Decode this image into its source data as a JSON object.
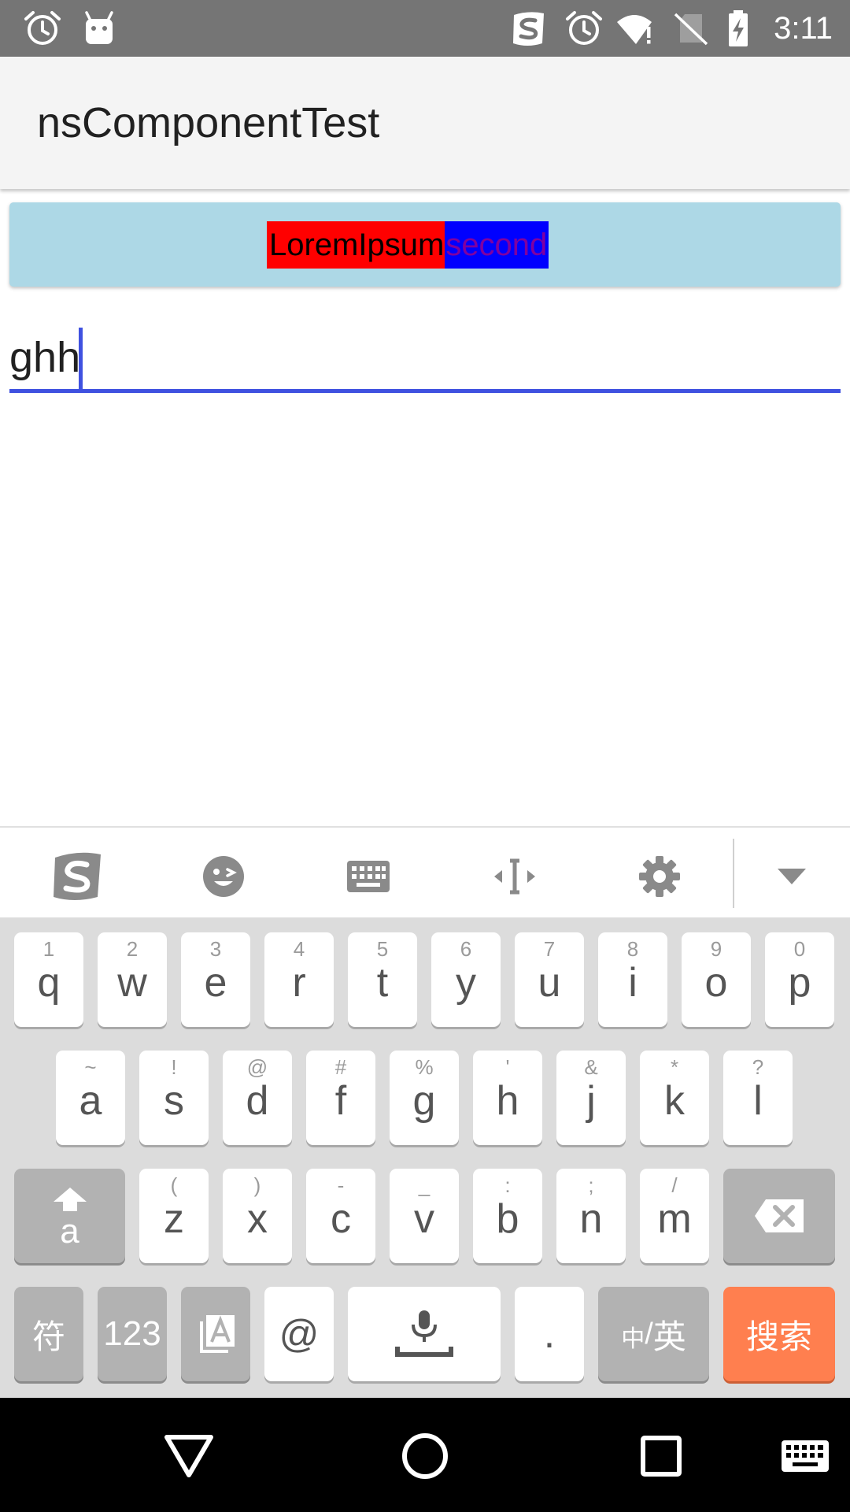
{
  "status_bar": {
    "time": "3:11",
    "icons": [
      "alarm-icon",
      "android-debug-icon",
      "sogou-icon",
      "alarm-icon",
      "wifi-warning-icon",
      "no-sim-icon",
      "battery-charging-icon"
    ],
    "background": "#757575"
  },
  "app_bar": {
    "title": "nsComponentTest",
    "background": "#f4f4f4"
  },
  "component": {
    "first_label": "LoremIpsum",
    "second_label": "second",
    "background": "#add8e6",
    "first_bg": "#ff0000",
    "second_bg": "#0000ff"
  },
  "text_field": {
    "value": "ghh",
    "accent": "#3f51e0"
  },
  "ime_toolbar": {
    "icons": [
      "sogou-logo-icon",
      "emoji-icon",
      "keyboard-icon",
      "cursor-move-icon",
      "settings-icon",
      "collapse-down-icon"
    ]
  },
  "keyboard": {
    "row1": [
      {
        "main": "q",
        "hint": "1"
      },
      {
        "main": "w",
        "hint": "2"
      },
      {
        "main": "e",
        "hint": "3"
      },
      {
        "main": "r",
        "hint": "4"
      },
      {
        "main": "t",
        "hint": "5"
      },
      {
        "main": "y",
        "hint": "6"
      },
      {
        "main": "u",
        "hint": "7"
      },
      {
        "main": "i",
        "hint": "8"
      },
      {
        "main": "o",
        "hint": "9"
      },
      {
        "main": "p",
        "hint": "0"
      }
    ],
    "row2": [
      {
        "main": "a",
        "hint": "~"
      },
      {
        "main": "s",
        "hint": "!"
      },
      {
        "main": "d",
        "hint": "@"
      },
      {
        "main": "f",
        "hint": "#"
      },
      {
        "main": "g",
        "hint": "%"
      },
      {
        "main": "h",
        "hint": "'"
      },
      {
        "main": "j",
        "hint": "&"
      },
      {
        "main": "k",
        "hint": "*"
      },
      {
        "main": "l",
        "hint": "?"
      }
    ],
    "row3": [
      {
        "main": "z",
        "hint": "("
      },
      {
        "main": "x",
        "hint": ")"
      },
      {
        "main": "c",
        "hint": "-"
      },
      {
        "main": "v",
        "hint": "_"
      },
      {
        "main": "b",
        "hint": ":"
      },
      {
        "main": "n",
        "hint": ";"
      },
      {
        "main": "m",
        "hint": "/"
      }
    ],
    "shift_label": "a",
    "symbols_label": "符",
    "numbers_label": "123",
    "at_label": "@",
    "period_label": ".",
    "lang_small": "中",
    "lang_sep": "/",
    "lang_big": "英",
    "action_label": "搜索",
    "action_color": "#ff7f4f"
  },
  "nav_bar": {
    "icons": [
      "back-icon",
      "home-icon",
      "recents-icon",
      "keyboard-switch-icon"
    ]
  }
}
